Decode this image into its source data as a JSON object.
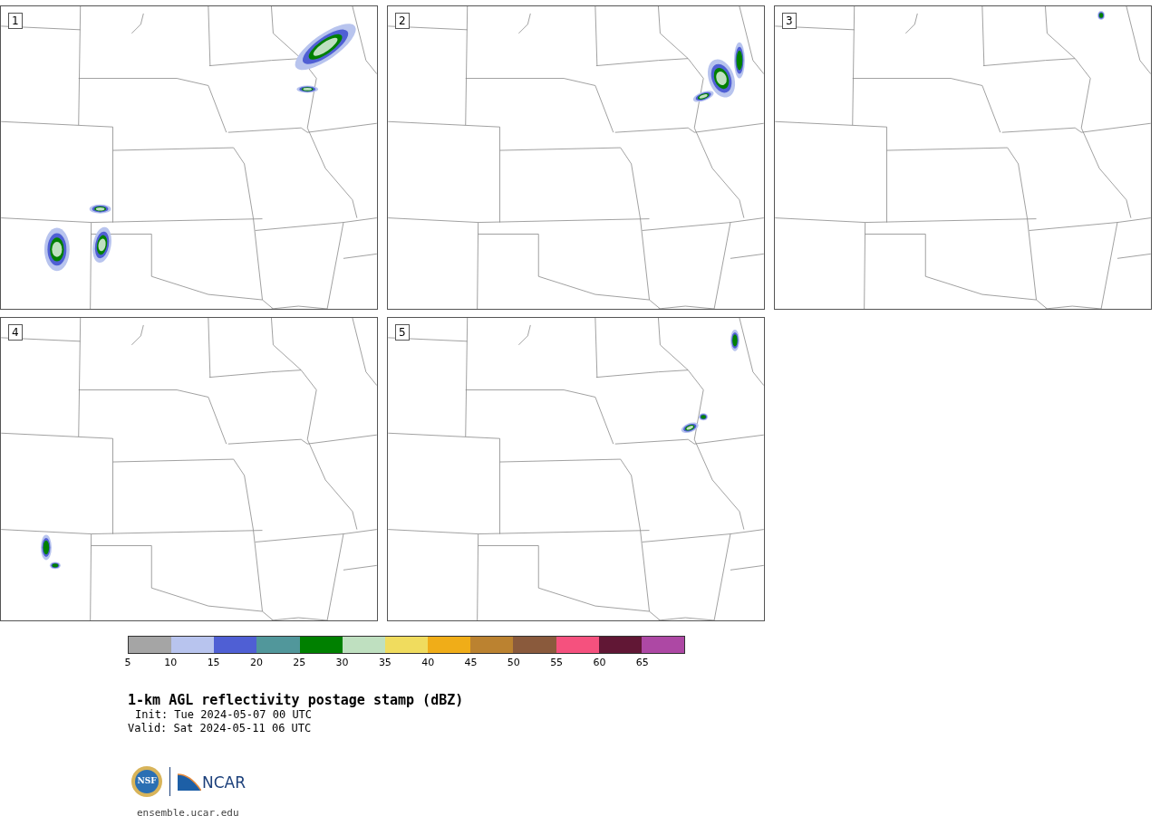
{
  "panels": [
    {
      "label": "1"
    },
    {
      "label": "2"
    },
    {
      "label": "3"
    },
    {
      "label": "4"
    },
    {
      "label": "5"
    }
  ],
  "colorbar": {
    "bins": [
      {
        "color": "#a5a5a5"
      },
      {
        "color": "#b8c4ee"
      },
      {
        "color": "#4f5fd4"
      },
      {
        "color": "#51979b"
      },
      {
        "color": "#008000"
      },
      {
        "color": "#bfe0c0"
      },
      {
        "color": "#f0dc5e"
      },
      {
        "color": "#f0ad18"
      },
      {
        "color": "#bb8230"
      },
      {
        "color": "#8a5a3c"
      },
      {
        "color": "#f5517e"
      },
      {
        "color": "#611735"
      },
      {
        "color": "#ad48a4"
      }
    ],
    "ticks": [
      "5",
      "10",
      "15",
      "20",
      "25",
      "30",
      "35",
      "40",
      "45",
      "50",
      "55",
      "60",
      "65"
    ]
  },
  "title": "1-km AGL reflectivity postage stamp (dBZ)",
  "init": "Init: Tue 2024-05-07 00 UTC",
  "valid": "Valid: Sat 2024-05-11 06 UTC",
  "logo": {
    "seal": "NSF",
    "wordmark": "NCAR"
  },
  "url": "ensemble.ucar.edu"
}
